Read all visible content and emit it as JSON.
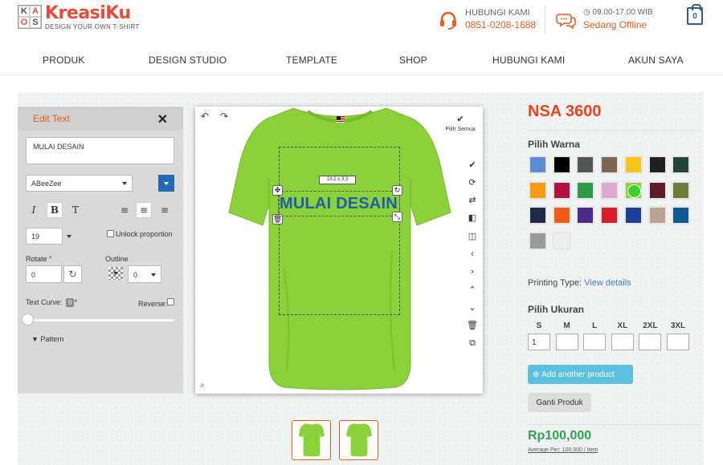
{
  "header": {
    "logo_letters": [
      "K",
      "A",
      "O",
      "S"
    ],
    "brand": "KreasiKu",
    "tagline": "DESIGN YOUR OWN T-SHIRT",
    "contact_label": "HUBUNGI KAMI",
    "contact_phone": "0851-0208-1688",
    "hours": "09.00-17.00 WIB",
    "status": "Sedang Offline",
    "cart_count": "0"
  },
  "nav": [
    "PRODUK",
    "DESIGN STUDIO",
    "TEMPLATE",
    "SHOP",
    "HUBUNGI KAMI",
    "AKUN SAYA"
  ],
  "edit_panel": {
    "title": "Edit Text",
    "text_value": "MULAI DESAIN",
    "font": "ABeeZee",
    "text_color": "#2369b5",
    "size": "19",
    "unlock_label": "Unlock proportion",
    "rotate_label": "Rotate °",
    "rotate_value": "0",
    "outline_label": "Outline",
    "outline_value": "0",
    "curve_label": "Text Curve:",
    "curve_value": "0",
    "reverse_label": "Reverse:",
    "pattern_label": "Pattern"
  },
  "canvas": {
    "pilih_semua": "Pilih Semua",
    "dimension": "19.2 x 3.3",
    "design_text": "MULAI DESAIN",
    "shirt_color": "#8bd13a"
  },
  "product": {
    "name": "NSA 3600",
    "color_title": "Pilih Warna",
    "colors": [
      "#5b8bd1",
      "#000000",
      "#555555",
      "#7d6554",
      "#f5c518",
      "#231f20",
      "#234534",
      "#f39c12",
      "#b5103e",
      "#2e9a47",
      "#dda9d2",
      "#8bd13a",
      "#5e1d27",
      "#6b7d3a",
      "#1f2a44",
      "#f35a12",
      "#4b2a8b",
      "#d91c2b",
      "#1d3f9a",
      "#b9a393",
      "#0e5a95",
      "#9a9a9a",
      "#eeeeee"
    ],
    "selected_color": "#8bd13a",
    "printing_type_label": "Printing Type:",
    "printing_type_link": "View details",
    "size_title": "Pilih Ukuran",
    "sizes": [
      "S",
      "M",
      "L",
      "XL",
      "2XL",
      "3XL"
    ],
    "size_values": [
      "1",
      "",
      "",
      "",
      "",
      ""
    ],
    "add_product": "Add another product",
    "ganti": "Ganti Produk",
    "price": "Rp100,000",
    "avg_price": "Average Per: 100,000 / Item"
  }
}
